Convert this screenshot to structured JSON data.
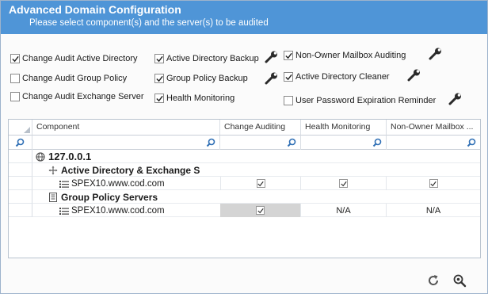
{
  "dialog": {
    "title": "Advanced Domain Configuration",
    "subtitle": "Please select component(s) and the server(s) to be audited"
  },
  "options": {
    "change_audit_ad": {
      "label": "Change Audit Active Directory",
      "checked": true
    },
    "change_audit_gp": {
      "label": "Change Audit Group Policy",
      "checked": false
    },
    "change_audit_exchange": {
      "label": "Change Audit Exchange Server",
      "checked": false
    },
    "ad_backup": {
      "label": "Active Directory Backup",
      "checked": true
    },
    "gp_backup": {
      "label": "Group Policy Backup",
      "checked": true
    },
    "health_monitoring": {
      "label": "Health Monitoring",
      "checked": true
    },
    "non_owner_mailbox": {
      "label": "Non-Owner Mailbox Auditing",
      "checked": true
    },
    "ad_cleaner": {
      "label": "Active Directory Cleaner",
      "checked": true
    },
    "password_reminder": {
      "label": "User Password Expiration Reminder",
      "checked": false
    }
  },
  "grid": {
    "columns": [
      "Component",
      "Change Auditing",
      "Health Monitoring",
      "Non-Owner Mailbox ..."
    ],
    "host": "127.0.0.1",
    "groups": [
      {
        "name": "Active Directory & Exchange S",
        "icon": "network-icon",
        "servers": [
          {
            "name": "SPEX10.www.cod.com",
            "change_auditing": "checked",
            "health_monitoring": "checked",
            "non_owner_mailbox": "checked"
          }
        ]
      },
      {
        "name": "Group Policy Servers",
        "icon": "document-list-icon",
        "servers": [
          {
            "name": "SPEX10.www.cod.com",
            "change_auditing": "checked",
            "health_monitoring": "N/A",
            "non_owner_mailbox": "N/A"
          }
        ]
      }
    ]
  },
  "footer": {
    "refresh_icon": "refresh-icon",
    "zoom_icon": "zoom-settings-icon"
  }
}
